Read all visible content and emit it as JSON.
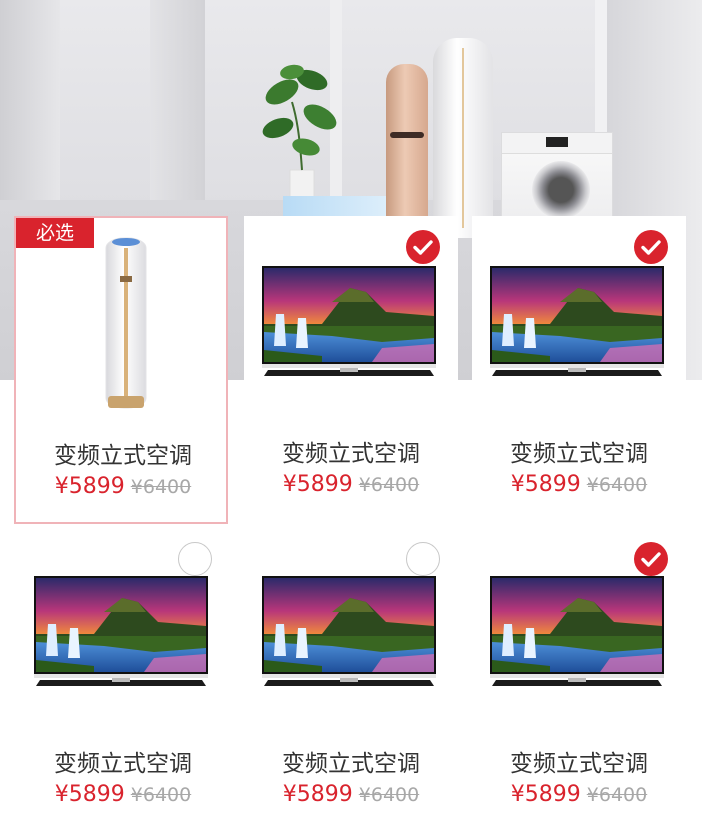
{
  "badge_label": "必选",
  "products": [
    {
      "name": "变频立式空调",
      "price": "¥5899",
      "original_price": "¥6400",
      "image": "floor-ac-icon",
      "selected": null
    },
    {
      "name": "变频立式空调",
      "price": "¥5899",
      "original_price": "¥6400",
      "image": "tv-icon",
      "selected": true
    },
    {
      "name": "变频立式空调",
      "price": "¥5899",
      "original_price": "¥6400",
      "image": "tv-icon",
      "selected": true
    },
    {
      "name": "变频立式空调",
      "price": "¥5899",
      "original_price": "¥6400",
      "image": "tv-icon",
      "selected": false
    },
    {
      "name": "变频立式空调",
      "price": "¥5899",
      "original_price": "¥6400",
      "image": "tv-icon",
      "selected": false
    },
    {
      "name": "变频立式空调",
      "price": "¥5899",
      "original_price": "¥6400",
      "image": "tv-icon",
      "selected": true
    }
  ],
  "colors": {
    "accent": "#d9232d",
    "selected_border": "#f0b3b8",
    "strike_price": "#a8a8a8"
  }
}
